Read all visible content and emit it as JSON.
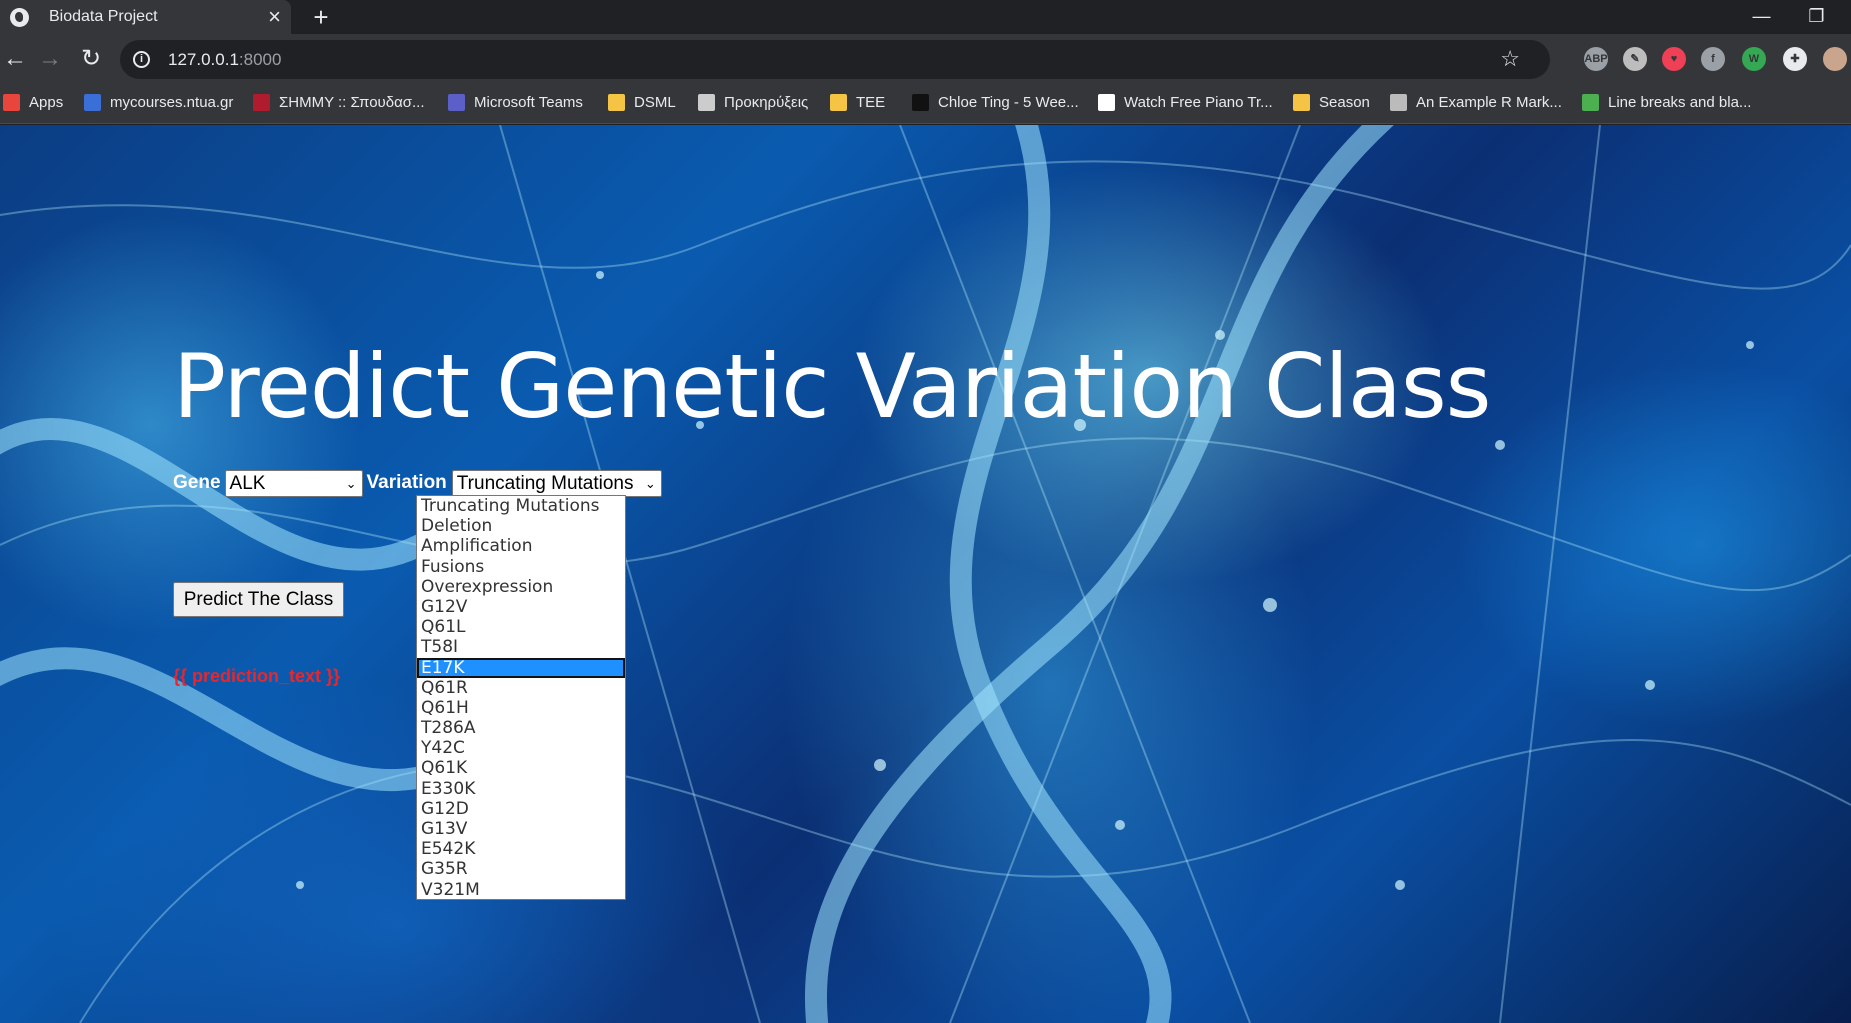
{
  "browser": {
    "tab_title": "Biodata Project",
    "url_host": "127.0.0.1",
    "url_port": ":8000",
    "bookmarks": [
      {
        "label": "Apps",
        "color": "#e8453c"
      },
      {
        "label": "mycourses.ntua.gr",
        "color": "#3a6fd8"
      },
      {
        "label": "ΣΗΜΜΥ :: Σπουδασ...",
        "color": "#b01c2e"
      },
      {
        "label": "Microsoft Teams",
        "color": "#5b5fc7"
      },
      {
        "label": "DSML",
        "color": "#f6c445"
      },
      {
        "label": "Προκηρύξεις",
        "color": "#cccccc"
      },
      {
        "label": "TEE",
        "color": "#f6c445"
      },
      {
        "label": "Chloe Ting - 5 Wee...",
        "color": "#111111"
      },
      {
        "label": "Watch Free Piano Tr...",
        "color": "#ffffff"
      },
      {
        "label": "Season",
        "color": "#f6c445"
      },
      {
        "label": "An Example R Mark...",
        "color": "#bbbbbb"
      },
      {
        "label": "Line breaks and bla...",
        "color": "#4caf50"
      }
    ],
    "extensions": [
      {
        "name": "adblock-plus-icon",
        "text": "ABP",
        "color": "#9aa0a6"
      },
      {
        "name": "pencil-extension-icon",
        "text": "✎",
        "color": "#bdbdbd"
      },
      {
        "name": "pocket-icon",
        "text": "♥",
        "color": "#ef4056"
      },
      {
        "name": "facebook-icon",
        "text": "f",
        "color": "#9aa0a6"
      },
      {
        "name": "wordpress-icon",
        "text": "W",
        "color": "#34a853"
      },
      {
        "name": "puzzle-extensions-icon",
        "text": "✚",
        "color": "#e8eaed"
      },
      {
        "name": "profile-avatar",
        "text": "",
        "color": "#c9a58d"
      }
    ]
  },
  "page": {
    "heading": "Predict Genetic Variation Class",
    "gene_label": "Gene",
    "gene_value": "ALK",
    "variation_label": "Variation",
    "variation_value": "Truncating Mutations",
    "variation_options": [
      "Truncating Mutations",
      "Deletion",
      "Amplification",
      "Fusions",
      "Overexpression",
      "G12V",
      "Q61L",
      "T58I",
      "E17K",
      "Q61R",
      "Q61H",
      "T286A",
      "Y42C",
      "Q61K",
      "E330K",
      "G12D",
      "G13V",
      "E542K",
      "G35R",
      "V321M"
    ],
    "highlighted_option": "E17K",
    "predict_button": "Predict The Class",
    "prediction_text": "{{ prediction_text }}"
  }
}
